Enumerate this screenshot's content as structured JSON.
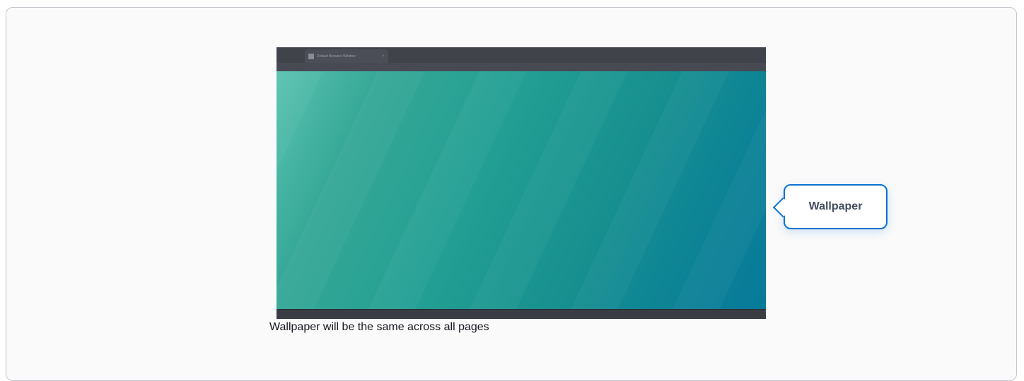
{
  "browser": {
    "tab_title": "Default Browser Window",
    "tab_close": "×"
  },
  "callout": {
    "label": "Wallpaper",
    "color": "#0972d3"
  },
  "caption": "Wallpaper will be the same across all pages",
  "colors": {
    "wallpaper_start": "#5bc2b1",
    "wallpaper_end": "#077a9a",
    "browser_chrome": "#41434b",
    "card_background": "#fafafa",
    "card_border": "#c6c6cd"
  }
}
